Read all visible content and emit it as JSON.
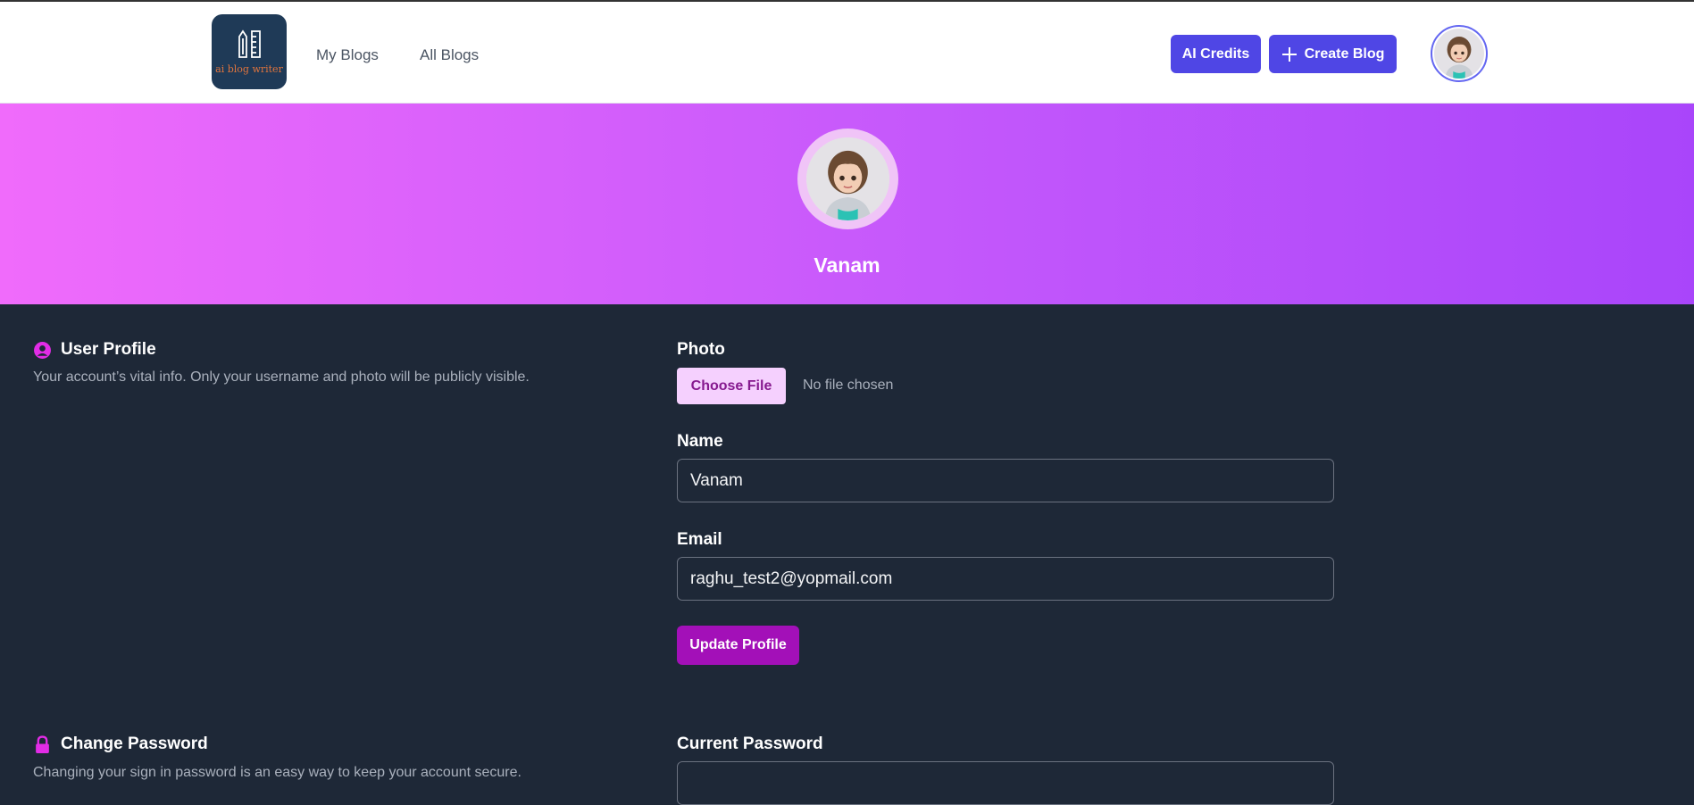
{
  "nav": {
    "logo_text": "ai blog writer",
    "links": [
      {
        "label": "My Blogs"
      },
      {
        "label": "All Blogs"
      }
    ],
    "ai_credits_label": "AI Credits",
    "create_blog_label": "Create Blog"
  },
  "banner": {
    "user_name": "Vanam"
  },
  "profile_section": {
    "title": "User Profile",
    "description": "Your account’s vital info. Only your username and photo will be publicly visible.",
    "photo_label": "Photo",
    "choose_file_label": "Choose File",
    "file_status": "No file chosen",
    "name_label": "Name",
    "name_value": "Vanam",
    "email_label": "Email",
    "email_value": "raghu_test2@yopmail.com",
    "update_label": "Update Profile"
  },
  "password_section": {
    "title": "Change Password",
    "description": "Changing your sign in password is an easy way to keep your account secure.",
    "current_password_label": "Current Password"
  },
  "colors": {
    "primary": "#4f46e5",
    "accent": "#a310b8",
    "icon_accent": "#e22ce6",
    "background": "#1e2837"
  }
}
